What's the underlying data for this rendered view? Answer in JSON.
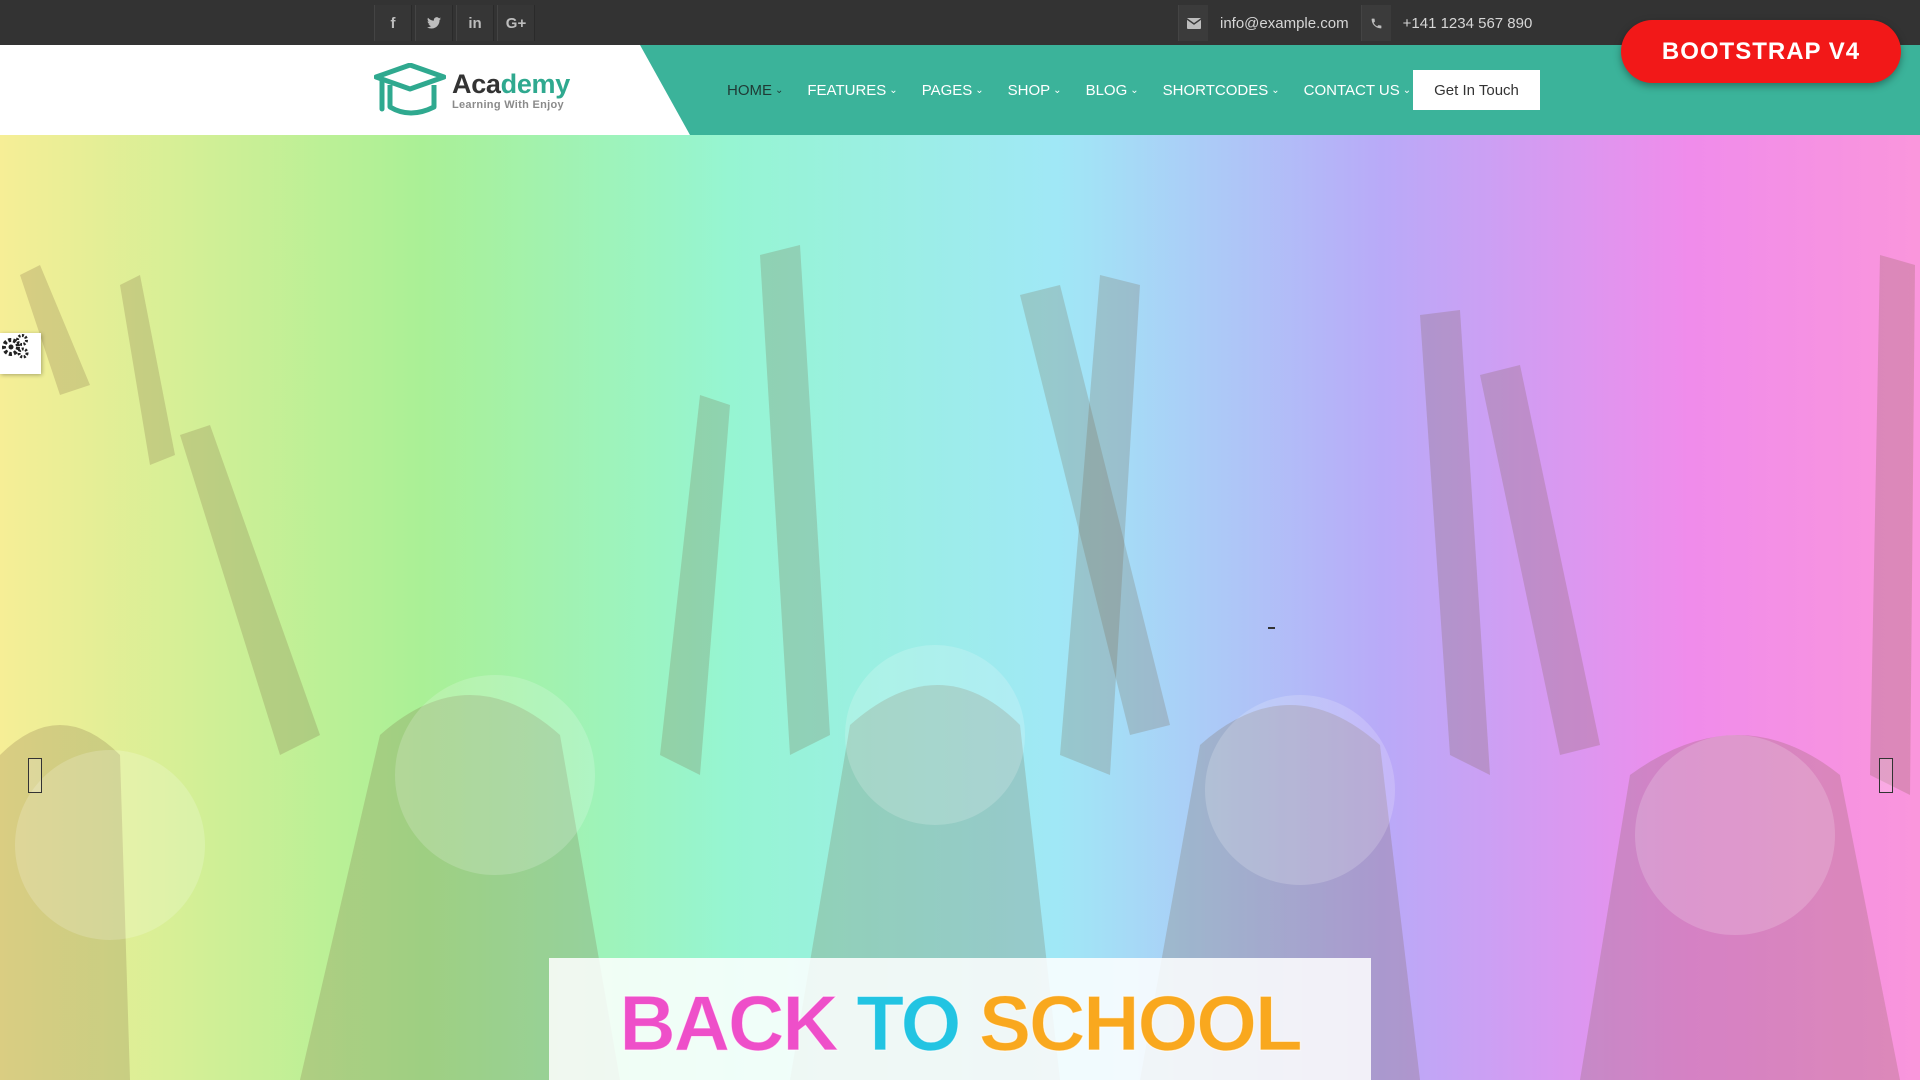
{
  "topbar": {
    "social": [
      {
        "icon": "facebook-icon",
        "glyph": "f"
      },
      {
        "icon": "twitter-icon",
        "glyph": "🐦"
      },
      {
        "icon": "linkedin-icon",
        "glyph": "in"
      },
      {
        "icon": "google-plus-icon",
        "glyph": "G+"
      }
    ],
    "email": "info@example.com",
    "phone": "+141 1234 567 890"
  },
  "logo": {
    "part1": "Aca",
    "part2": "demy",
    "tagline": "Learning With Enjoy"
  },
  "nav": {
    "items": [
      {
        "label": "HOME",
        "active": true
      },
      {
        "label": "FEATURES",
        "active": false
      },
      {
        "label": "PAGES",
        "active": false
      },
      {
        "label": "SHOP",
        "active": false
      },
      {
        "label": "BLOG",
        "active": false
      },
      {
        "label": "SHORTCODES",
        "active": false
      },
      {
        "label": "CONTACT US",
        "active": false
      }
    ],
    "cta": "Get In Touch"
  },
  "badge": "BOOTSTRAP V4",
  "hero": {
    "headline": [
      {
        "text": "BACK",
        "color": "#ee4fc9"
      },
      {
        "text": "TO",
        "color": "#22c4e2"
      },
      {
        "text": "SCHOOL",
        "color": "#f9a81e"
      }
    ]
  },
  "colors": {
    "accent": "#3bb39a",
    "topbar": "#333333",
    "badge": "#f21818"
  }
}
